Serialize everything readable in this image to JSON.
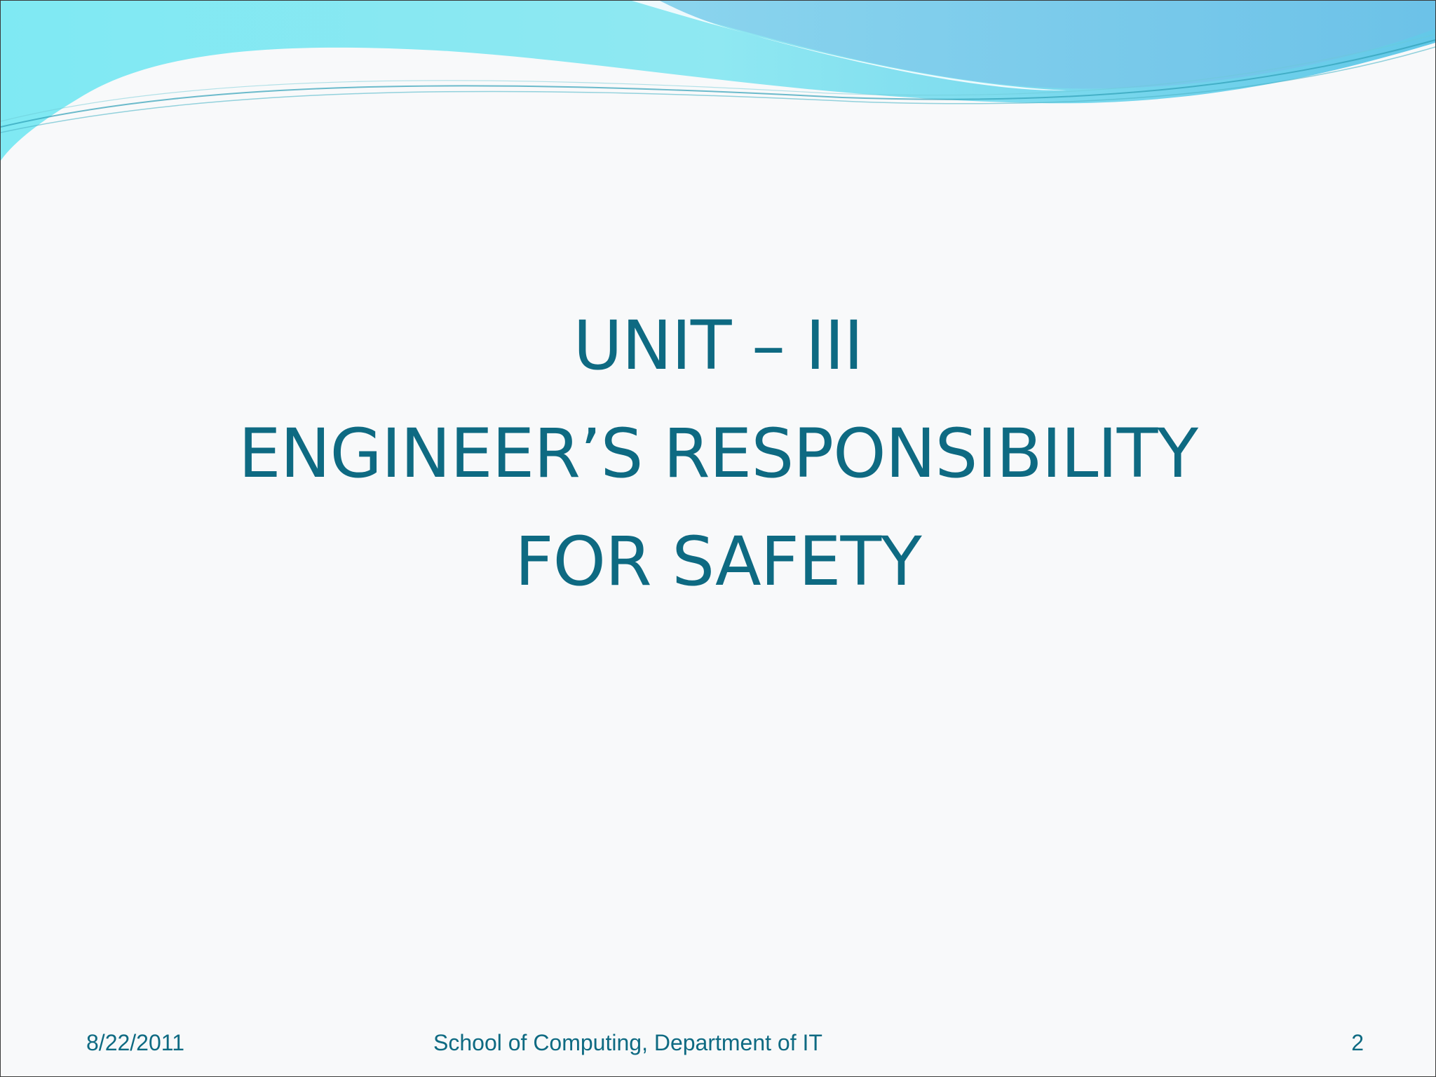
{
  "slide": {
    "title_lines": [
      "UNIT – III",
      "ENGINEER’S RESPONSIBILITY",
      "FOR SAFETY"
    ]
  },
  "footer": {
    "date": "8/22/2011",
    "center_text": "School of Computing, Department of IT",
    "page_number": "2"
  },
  "theme": {
    "title_color": "#0e6a82",
    "wave_light": "#8eeaf2",
    "wave_blue": "#7cc4ea"
  }
}
